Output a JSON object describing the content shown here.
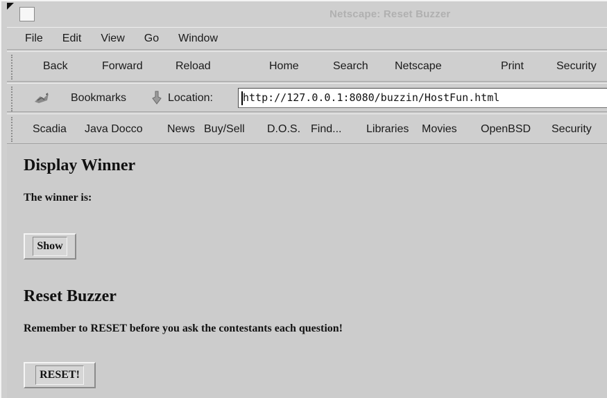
{
  "window": {
    "title": "Netscape: Reset Buzzer"
  },
  "menubar": {
    "items": [
      "File",
      "Edit",
      "View",
      "Go",
      "Window"
    ]
  },
  "toolbar": {
    "back": "Back",
    "forward": "Forward",
    "reload": "Reload",
    "home": "Home",
    "search": "Search",
    "netscape": "Netscape",
    "print": "Print",
    "security": "Security"
  },
  "locationbar": {
    "bookmarks_label": "Bookmarks",
    "location_label": "Location:",
    "url": "http://127.0.0.1:8080/buzzin/HostFun.html"
  },
  "personal_toolbar": {
    "items": [
      "Scadia",
      "Java Docco",
      "News",
      "Buy/Sell",
      "D.O.S.",
      "Find...",
      "Libraries",
      "Movies",
      "OpenBSD",
      "Security"
    ]
  },
  "page": {
    "display_heading": "Display Winner",
    "winner_text": "The winner is:",
    "show_button": "Show",
    "reset_heading": "Reset Buzzer",
    "reset_text": "Remember to RESET before you ask the contestants each question!",
    "reset_button": "RESET!"
  }
}
